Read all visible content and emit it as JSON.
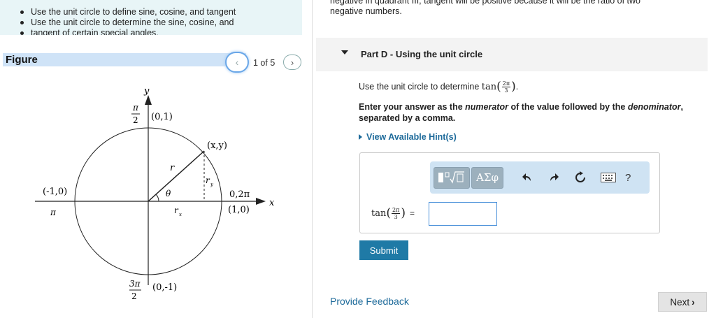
{
  "objectives": [
    "Use the unit circle to define sine, cosine, and tangent",
    "Use the unit circle to determine the sine, cosine, and",
    "tangent of certain special angles."
  ],
  "top_right_text": [
    "negative in quadrant III, tangent will be positive because it will be the ratio of two",
    "negative numbers."
  ],
  "figure": {
    "label": "Figure",
    "counter": "1 of 5",
    "prev_icon": "chevron-left-icon",
    "next_icon": "chevron-right-icon",
    "diagram": {
      "axis_y": "y",
      "axis_x": "x",
      "top_point": "(0,1)",
      "top_angle_num": "π",
      "top_angle_den": "2",
      "left_point": "(-1,0)",
      "left_angle": "π",
      "right_point": "(1,0)",
      "right_angle": "0,2π",
      "bottom_point": "(0,-1)",
      "bottom_angle_num": "3π",
      "bottom_angle_den": "2",
      "circle_point": "(x,y)",
      "radius": "r",
      "theta": "θ",
      "rx": "r",
      "rx_sub": "x",
      "ry": "r",
      "ry_sub": "y"
    }
  },
  "part": {
    "title": "Part D - Using the unit circle",
    "question_prefix": "Use the unit circle to determine",
    "func": "tan",
    "frac_num": "2π",
    "frac_den": "3",
    "question_suffix": ".",
    "instruct_1": "Enter your answer as the ",
    "instruct_em1": "numerator",
    "instruct_2": " of the value followed by the ",
    "instruct_em2": "denominator",
    "instruct_3": ",",
    "instruct_4": "separated by a comma.",
    "hints_label": "View Available Hint(s)"
  },
  "toolbar": {
    "templates_icon": "templates-icon",
    "symbols_label": "ΑΣφ",
    "undo_icon": "undo-icon",
    "redo_icon": "redo-icon",
    "reset_icon": "reset-icon",
    "keyboard_icon": "keyboard-icon",
    "help_label": "?"
  },
  "answer": {
    "func": "tan",
    "frac_num": "2π",
    "frac_den": "3",
    "equals": "=",
    "value": ""
  },
  "buttons": {
    "submit": "Submit",
    "feedback": "Provide Feedback",
    "next": "Next"
  },
  "colors": {
    "accent": "#1f7aa6",
    "link": "#1d6a9a",
    "objectives_bg": "#e8f5f7",
    "figure_bar": "#cfe3f7"
  }
}
